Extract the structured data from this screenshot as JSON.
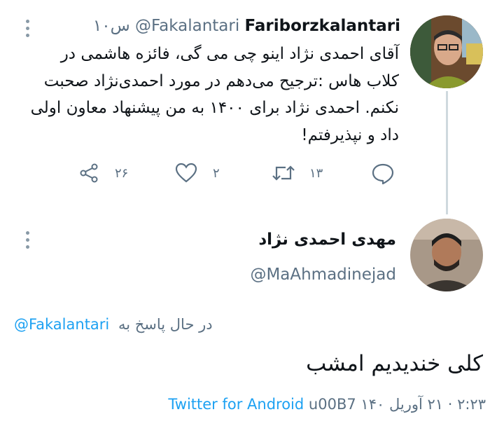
{
  "tweet": {
    "display_name": "Fariborzkalantari",
    "handle": "@Fakalantari",
    "time": "۱۰س",
    "body": "آقای احمدی نژاد اینو چی می گی، فائزه هاشمی در کلاب هاس :ترجیح می‌دهم در مورد احمدی‌نژاد صحبت نکنم. احمدی نژاد برای ۱۴۰۰ به من پیشنهاد معاون اولی داد و نپذیرفتم!",
    "actions": {
      "reply_icon": "reply-icon",
      "retweet_icon": "retweet-icon",
      "retweet_count": "۱۳",
      "like_icon": "heart-icon",
      "like_count": "۲",
      "share_icon": "share-icon",
      "share_count": "۲۶"
    }
  },
  "reply": {
    "display_name": "مهدی احمدی نژاد",
    "handle": "@MaAhmadinejad",
    "replying_to_label": "در حال پاسخ به",
    "replying_to_handle": "@Fakalantari",
    "body": "کلی خندیدیم امشب",
    "meta_time": "۲:۲۳ · ۲۱ آوریل ۱۴۰",
    "meta_sep": "u00B7",
    "source": "Twitter for Android"
  },
  "colors": {
    "link": "#1da1f2",
    "secondary_text": "#5b7083",
    "thread_line": "#cfd9de"
  }
}
